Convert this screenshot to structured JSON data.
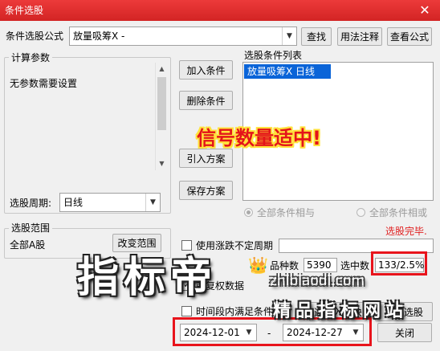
{
  "window": {
    "title": "条件选股",
    "close_glyph": "✕"
  },
  "formula": {
    "label": "条件选股公式",
    "value": "放量吸筹X  -",
    "find_button": "查找",
    "usage_button": "用法注释",
    "view_button": "查看公式"
  },
  "params": {
    "group_title": "计算参数",
    "message": "无参数需要设置"
  },
  "period": {
    "label": "选股周期:",
    "value": "日线"
  },
  "condition_buttons": {
    "add": "加入条件",
    "delete": "删除条件",
    "import": "引入方案",
    "save": "保存方案"
  },
  "condition_list": {
    "title": "选股条件列表",
    "items": [
      "放量吸筹X  日线"
    ]
  },
  "signal_overlay": "信号数量适中!",
  "logic": {
    "and_label": "全部条件相与",
    "or_label": "全部条件相或"
  },
  "status": {
    "text": "选股完毕."
  },
  "scope": {
    "group_title": "选股范围",
    "value": "全部A股",
    "change_button": "改变范围"
  },
  "stats": {
    "use_irregular_label": "使用涨跌不定周期",
    "count_label": "品种数",
    "count_value": "5390",
    "selected_label": "选中数",
    "selected_value": "133/2.5%"
  },
  "options": {
    "pre_adjust_label": "前复权数据",
    "time_range_label": "时间段内满足条件"
  },
  "watermark": {
    "main": "指标帝",
    "sub": "精品指标网站",
    "url": "zhibiaodi.com"
  },
  "buttons": {
    "run": "选股入板块",
    "execute": "执行选股",
    "close": "关闭"
  },
  "dates": {
    "start": "2024-12-01",
    "separator": "-",
    "end": "2024-12-27"
  },
  "colors": {
    "title_bar": "#d32424",
    "selection": "#0a64d8",
    "highlight_red": "#e8141c",
    "status_red": "#e02020"
  }
}
